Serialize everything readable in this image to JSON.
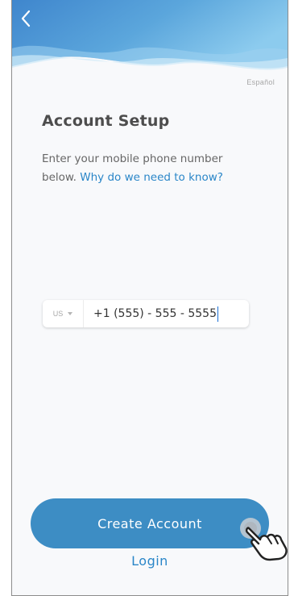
{
  "header": {
    "back_icon": "chevron-left-icon",
    "gradient_colors": [
      "#4a8fd0",
      "#8cc9ec"
    ]
  },
  "language": {
    "label": "Español"
  },
  "title": "Account Setup",
  "intro": {
    "text": "Enter your mobile phone number below.",
    "link": "Why do we need to know?"
  },
  "phone": {
    "country_code": "US",
    "value": "+1 (555) - 555 - 5555"
  },
  "actions": {
    "create_account": "Create Account",
    "login": "Login"
  },
  "colors": {
    "primary": "#3d8dc4",
    "link": "#2a86c8",
    "title": "#4d4d4d"
  },
  "tap_indicator": "hand-pointer-icon"
}
